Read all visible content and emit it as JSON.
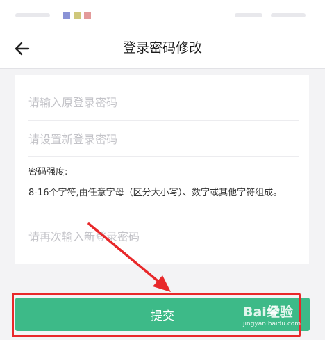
{
  "nav": {
    "title": "登录密码修改"
  },
  "form": {
    "old_password_placeholder": "请输入原登录密码",
    "new_password_placeholder": "请设置新登录密码",
    "strength_label": "密码强度:",
    "strength_desc": "8-16个字符,由任意字母（区分大小写）、数字或其他字符组成。",
    "confirm_password_placeholder": "请再次输入新登录密码"
  },
  "actions": {
    "submit_label": "提交"
  },
  "watermark": {
    "logo": "Bai经验",
    "url": "jingyan.baidu.com"
  },
  "icons": {
    "back": "arrow-left-icon",
    "paw": "paw-icon"
  },
  "colors": {
    "primary": "#3dba88",
    "annotation": "#e8282a",
    "placeholder": "#c3c3c8",
    "background": "#f3f3f5"
  }
}
